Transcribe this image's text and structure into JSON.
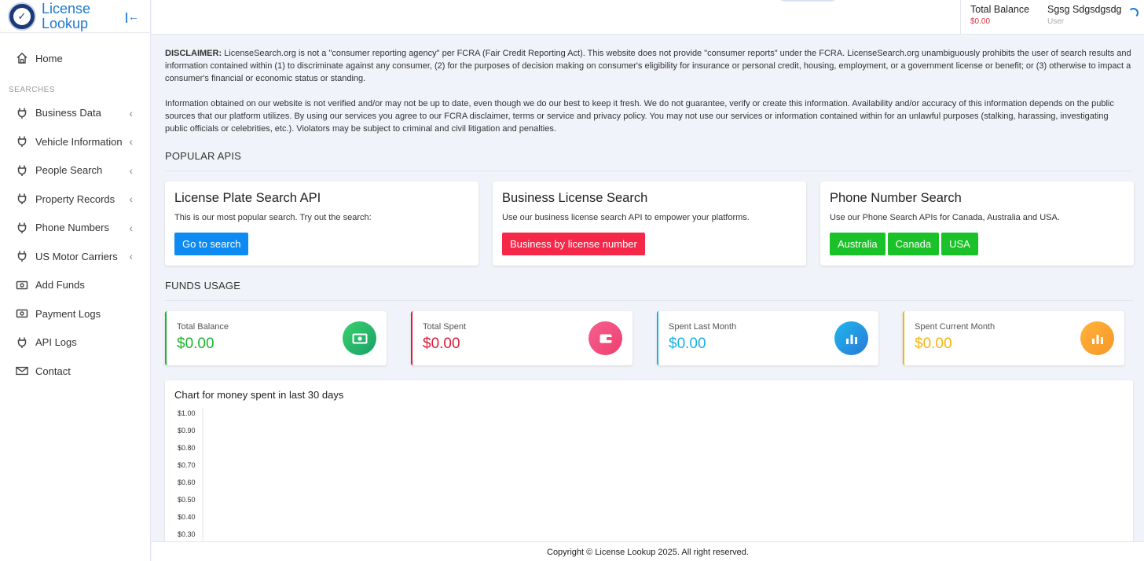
{
  "brand": {
    "name": "License Lookup"
  },
  "sidebar": {
    "home": "Home",
    "section_label": "SEARCHES",
    "items": [
      {
        "label": "Business Data",
        "icon": "plug-icon",
        "expandable": true
      },
      {
        "label": "Vehicle Information",
        "icon": "plug-icon",
        "expandable": true
      },
      {
        "label": "People Search",
        "icon": "plug-icon",
        "expandable": true
      },
      {
        "label": "Property Records",
        "icon": "plug-icon",
        "expandable": true
      },
      {
        "label": "Phone Numbers",
        "icon": "plug-icon",
        "expandable": true
      },
      {
        "label": "US Motor Carriers",
        "icon": "plug-icon",
        "expandable": true
      },
      {
        "label": "Add Funds",
        "icon": "money-icon",
        "expandable": false
      },
      {
        "label": "Payment Logs",
        "icon": "money-icon",
        "expandable": false
      },
      {
        "label": "API Logs",
        "icon": "plug-icon",
        "expandable": false
      },
      {
        "label": "Contact",
        "icon": "envelope-icon",
        "expandable": false
      }
    ]
  },
  "header": {
    "balance_label": "Total Balance",
    "balance_value": "$0.00",
    "user_name": "Sgsg Sdgsdgsdg",
    "user_role": "User"
  },
  "disclaimer": {
    "prefix": "DISCLAIMER:",
    "text1": " LicenseSearch.org is not a \"consumer reporting agency\" per FCRA (Fair Credit Reporting Act). This website does not provide \"consumer reports\" under the FCRA. LicenseSearch.org unambiguously prohibits the user of search results and information contained within (1) to discriminate against any consumer, (2) for the purposes of decision making on consumer's eligibility for insurance or personal credit, housing, employment, or a government license or benefit; or (3) otherwise to impact a consumer's financial or economic status or standing.",
    "text2": "Information obtained on our website is not verified and/or may not be up to date, even though we do our best to keep it fresh. We do not guarantee, verify or create this information. Availability and/or accuracy of this information depends on the public sources that our platform utilizes. By using our services you agree to our FCRA disclaimer, terms or service and privacy policy. You may not use our services or information contained within for an unlawful purposes (stalking, harassing, investigating public officials or celebrities, etc.). Violators may be subject to criminal and civil litigation and penalties."
  },
  "popular_apis": {
    "title": "POPULAR APIS",
    "cards": [
      {
        "title": "License Plate Search API",
        "desc": "This is our most popular search. Try out the search:",
        "buttons": [
          "Go to search"
        ]
      },
      {
        "title": "Business License Search",
        "desc": "Use our business license search API to empower your platforms.",
        "buttons": [
          "Business by license number"
        ]
      },
      {
        "title": "Phone Number Search",
        "desc": "Use our Phone Search APIs for Canada, Australia and USA.",
        "buttons": [
          "Australia",
          "Canada",
          "USA"
        ]
      }
    ]
  },
  "funds_usage": {
    "title": "FUNDS USAGE",
    "stats": [
      {
        "label": "Total Balance",
        "value": "$0.00",
        "color": "#1bb52a",
        "icon": "money-icon"
      },
      {
        "label": "Total Spent",
        "value": "$0.00",
        "color": "#dc1c3a",
        "icon": "wallet-icon"
      },
      {
        "label": "Spent Last Month",
        "value": "$0.00",
        "color": "#16b2e8",
        "icon": "bar-chart-icon"
      },
      {
        "label": "Spent Current Month",
        "value": "$0.00",
        "color": "#f5b40e",
        "icon": "bar-chart-icon"
      }
    ]
  },
  "chart_data": {
    "type": "line",
    "title": "Chart for money spent in last 30 days",
    "yticks": [
      "$1.00",
      "$0.90",
      "$0.80",
      "$0.70",
      "$0.60",
      "$0.50",
      "$0.40",
      "$0.30"
    ],
    "ylim": [
      0.3,
      1.0
    ],
    "series": []
  },
  "footer": {
    "text": "Copyright © License Lookup 2025. All right reserved."
  },
  "colors": {
    "accent": "#1f78d1",
    "blue_button": "#0d8bf2",
    "red_button": "#f5284a",
    "green_button": "#1bc128"
  }
}
